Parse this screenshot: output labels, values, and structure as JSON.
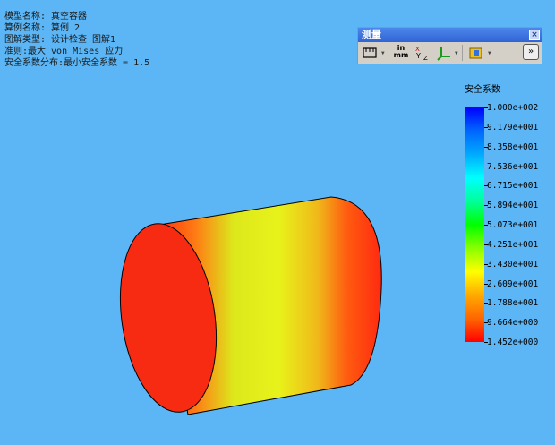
{
  "info": {
    "line1": "模型名称: 真空容器",
    "line2": "算例名称: 算例 2",
    "line3": "图解类型: 设计检查 图解1",
    "line4": "准则:最大 von Mises 应力",
    "line5": "安全系数分布:最小安全系数 = 1.5"
  },
  "toolbar": {
    "title": "测量",
    "close": "×",
    "units_top": "in",
    "units_bottom": "mm",
    "more": "»",
    "icons": [
      "measure-icon",
      "units-icon",
      "xyz-icon",
      "coordinate-icon",
      "folder-icon",
      "more-icon"
    ]
  },
  "legend": {
    "title": "安全系数",
    "labels": [
      "1.000e+002",
      "9.179e+001",
      "8.358e+001",
      "7.536e+001",
      "6.715e+001",
      "5.894e+001",
      "5.073e+001",
      "4.251e+001",
      "3.430e+001",
      "2.609e+001",
      "1.788e+001",
      "9.664e+000",
      "1.452e+000"
    ]
  },
  "colors": {
    "background": "#5cb6f6",
    "model_high": "#ff2a10",
    "model_mid": "#e8f21a"
  }
}
